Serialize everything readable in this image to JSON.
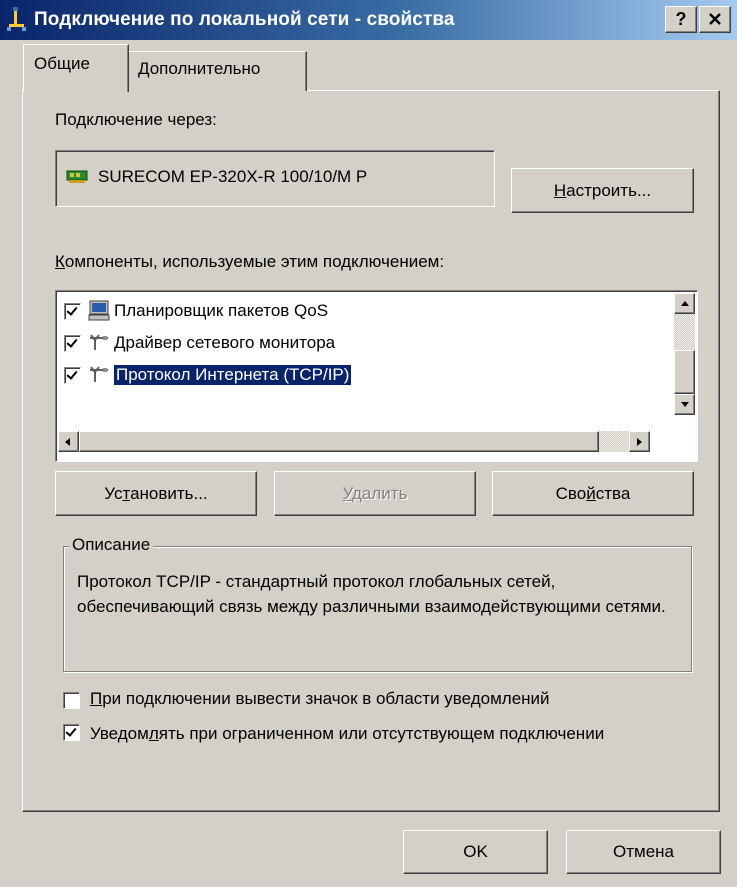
{
  "window": {
    "title": "Подключение по локальной сети - свойства",
    "help_label": "?",
    "close_label": "✕"
  },
  "tabs": [
    {
      "label": "Общие",
      "active": true
    },
    {
      "label": "Дополнительно",
      "active": false
    }
  ],
  "connect_via_label": "Подключение через:",
  "adapter_name": "SURECOM EP-320X-R 100/10/M P",
  "configure_button": "Настроить...",
  "components_label": "Компоненты, используемые этим подключением:",
  "components": [
    {
      "label": "Планировщик пакетов QoS",
      "checked": true,
      "icon": "qos-scheduler-icon",
      "selected": false
    },
    {
      "label": "Драйвер сетевого монитора",
      "checked": true,
      "icon": "network-protocol-icon",
      "selected": false
    },
    {
      "label": "Протокол Интернета (TCP/IP)",
      "checked": true,
      "icon": "network-protocol-icon",
      "selected": true
    }
  ],
  "buttons": {
    "install": "Установить...",
    "uninstall": "Удалить",
    "properties": "Свойства",
    "ok": "OK",
    "cancel": "Отмена"
  },
  "description": {
    "legend": "Описание",
    "text": "Протокол TCP/IP - стандартный протокол глобальных сетей, обеспечивающий связь между различными взаимодействующими сетями."
  },
  "options": [
    {
      "label": "При подключении вывести значок в области уведомлений",
      "checked": false
    },
    {
      "label": "Уведомлять при ограниченном или отсутствующем подключении",
      "checked": true
    }
  ],
  "colors": {
    "face": "#d4d0c8",
    "title_start": "#0a246a",
    "title_end": "#a6caf0",
    "selection": "#0a246a"
  }
}
